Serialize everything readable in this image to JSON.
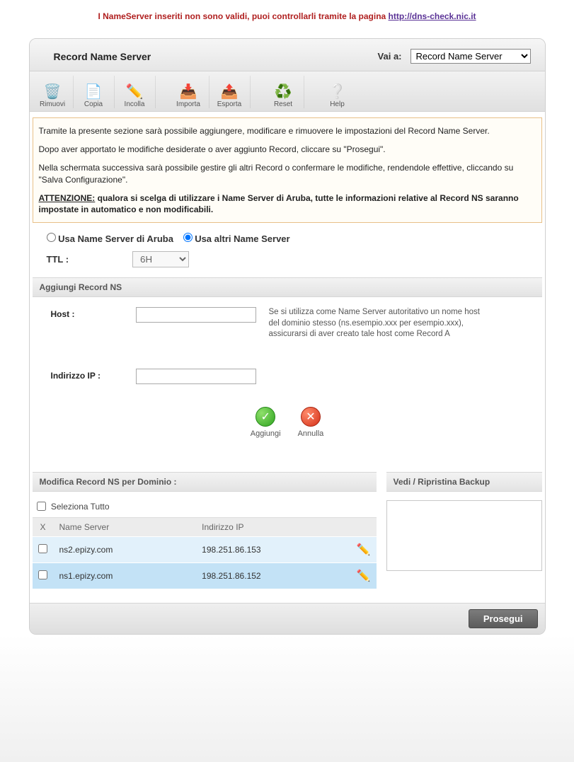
{
  "warning": {
    "text_prefix": "I NameServer inseriti non sono validi, puoi controllarli tramite la pagina ",
    "link_label": "http://dns-check.nic.it"
  },
  "header": {
    "title": "Record Name Server",
    "goto_label": "Vai a:",
    "goto_selected": "Record Name Server"
  },
  "toolbar": {
    "remove": "Rimuovi",
    "copy": "Copia",
    "paste": "Incolla",
    "import": "Importa",
    "export": "Esporta",
    "reset": "Reset",
    "help": "Help"
  },
  "info": {
    "p1": "Tramite la presente sezione sarà possibile aggiungere, modificare e rimuovere le impostazioni del Record Name Server.",
    "p2": "Dopo aver apportato le modifiche desiderate o aver aggiunto Record, cliccare su \"Prosegui\".",
    "p3": "Nella schermata successiva sarà possibile gestire gli altri Record o confermare le modifiche, rendendole effettive, cliccando su \"Salva Configurazione\".",
    "attn_label": "ATTENZIONE:",
    "attn_text": " qualora si scelga di utilizzare i Name Server di Aruba, tutte le informazioni relative al Record NS saranno impostate in automatico e non modificabili."
  },
  "radio": {
    "aruba": "Usa Name Server di Aruba",
    "other": "Usa altri Name Server",
    "selected": "other"
  },
  "ttl": {
    "label": "TTL :",
    "value": "6H"
  },
  "add_ns": {
    "section": "Aggiungi Record NS",
    "host_label": "Host :",
    "host_value": "",
    "host_hint": "Se si utilizza come Name Server autoritativo un nome host del dominio stesso (ns.esempio.xxx per esempio.xxx), assicurarsi di aver creato tale host come Record A",
    "ip_label": "Indirizzo IP :",
    "ip_value": "",
    "add_btn": "Aggiungi",
    "cancel_btn": "Annulla"
  },
  "modify": {
    "section": "Modifica Record NS per Dominio :",
    "select_all": "Seleziona Tutto",
    "col_x": "X",
    "col_ns": "Name Server",
    "col_ip": "Indirizzo IP",
    "rows": [
      {
        "ns": "ns2.epizy.com",
        "ip": "198.251.86.153"
      },
      {
        "ns": "ns1.epizy.com",
        "ip": "198.251.86.152"
      }
    ]
  },
  "backup": {
    "section": "Vedi / Ripristina Backup"
  },
  "footer": {
    "proceed": "Prosegui"
  }
}
